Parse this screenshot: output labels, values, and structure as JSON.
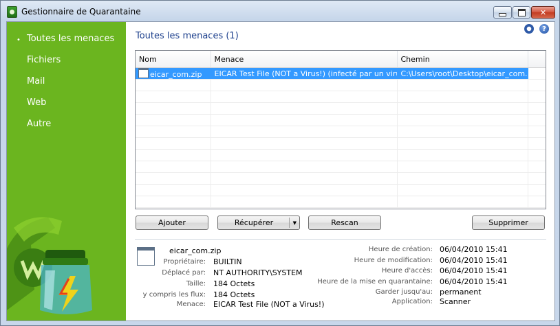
{
  "window": {
    "title": "Gestionnaire de Quarantaine",
    "controls": {
      "minimize": "minimize-icon",
      "maximize": "maximize-icon",
      "close": "✕"
    }
  },
  "sidebar": {
    "items": [
      {
        "label": "Toutes les menaces",
        "selected": true,
        "bullet": "•"
      },
      {
        "label": "Fichiers"
      },
      {
        "label": "Mail"
      },
      {
        "label": "Web"
      },
      {
        "label": "Autre"
      }
    ]
  },
  "main": {
    "title": "Toutes les menaces (1)",
    "icons": {
      "settings": "gear-icon",
      "help": "?"
    }
  },
  "table": {
    "columns": [
      "Nom",
      "Menace",
      "Chemin"
    ],
    "rows": [
      {
        "name": "eicar_com.zip",
        "threat": "EICAR Test File (NOT a Virus!) (infecté par un virus)",
        "path": "C:\\Users\\root\\Desktop\\eicar_com.zip",
        "selected": true
      }
    ]
  },
  "buttons": {
    "add": "Ajouter",
    "restore": "Récupérer",
    "restore_arrow": "▼",
    "rescan": "Rescan",
    "delete": "Supprimer"
  },
  "details": {
    "file_name": "eicar_com.zip",
    "left": [
      {
        "label": "Propriétaire:",
        "value": "BUILTIN"
      },
      {
        "label": "Déplacé par:",
        "value": "NT AUTHORITY\\SYSTEM"
      },
      {
        "label": "Taille:",
        "value": "184 Octets"
      },
      {
        "label": "y compris les flux:",
        "value": "184 Octets"
      },
      {
        "label": "Menace:",
        "value": "EICAR Test File (NOT a Virus!)"
      }
    ],
    "right": [
      {
        "label": "Heure de création:",
        "value": "06/04/2010 15:41"
      },
      {
        "label": "Heure de modification:",
        "value": "06/04/2010 15:41"
      },
      {
        "label": "Heure d'accès:",
        "value": "06/04/2010 15:41"
      },
      {
        "label": "Heure de la mise en quarantaine:",
        "value": "06/04/2010 15:41"
      },
      {
        "label": "Garder jusqu'au:",
        "value": "permanent"
      },
      {
        "label": "Application:",
        "value": "Scanner"
      }
    ]
  },
  "colors": {
    "sidebar": "#6bb51f",
    "title": "#1c3f8c",
    "selection": "#3399ff"
  }
}
